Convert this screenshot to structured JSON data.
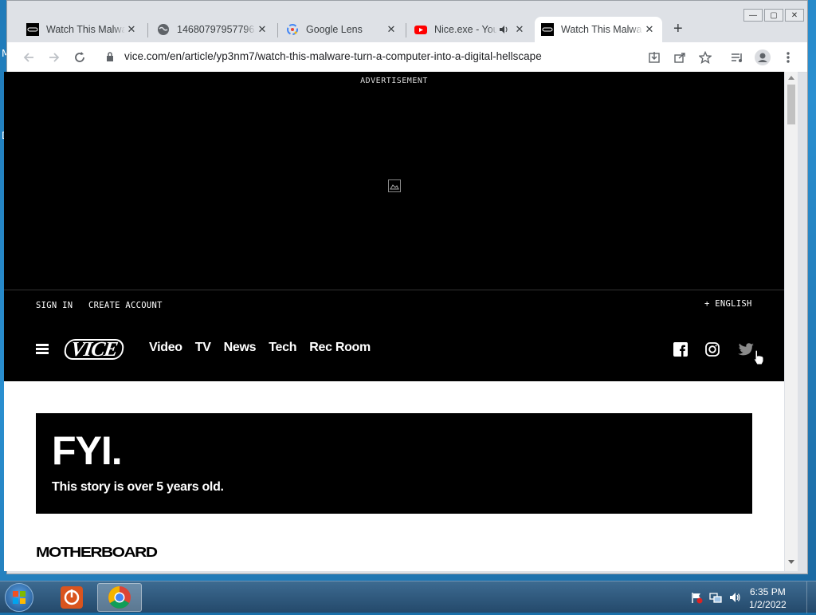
{
  "desktop": {
    "edge_letters": [
      "M",
      "D"
    ]
  },
  "window_controls": {
    "minimize": "—",
    "maximize": "▢",
    "close": "✕"
  },
  "tabs": [
    {
      "title": "Watch This Malwa",
      "icon": "vice-favicon"
    },
    {
      "title": "14680797957796",
      "icon": "globe-icon"
    },
    {
      "title": "Google Lens",
      "icon": "google-lens-icon"
    },
    {
      "title": "Nice.exe - You",
      "icon": "youtube-icon",
      "audio": true
    },
    {
      "title": "Watch This Malwa",
      "icon": "vice-favicon",
      "active": true
    }
  ],
  "tab_close": "✕",
  "new_tab": "+",
  "toolbar": {
    "url": "vice.com/en/article/yp3nm7/watch-this-malware-turn-a-computer-into-a-digital-hellscape"
  },
  "page": {
    "ad_label": "ADVERTISEMENT",
    "account": {
      "sign_in": "SIGN IN",
      "create_account": "CREATE ACCOUNT",
      "language": "+ ENGLISH"
    },
    "nav": {
      "logo": "VICE",
      "links": [
        "Video",
        "TV",
        "News",
        "Tech",
        "Rec Room"
      ]
    },
    "fyi": {
      "title": "FYI.",
      "subtitle": "This story is over 5 years old."
    },
    "section_logo": "MOTHERBOARD"
  },
  "taskbar": {
    "time": "6:35 PM",
    "date": "1/2/2022"
  },
  "colors": {
    "page_bg": "#000000",
    "vice_white": "#ffffff",
    "tab_strip": "#dee1e6",
    "youtube_red": "#ff0000",
    "avast_orange": "#d9541e"
  }
}
